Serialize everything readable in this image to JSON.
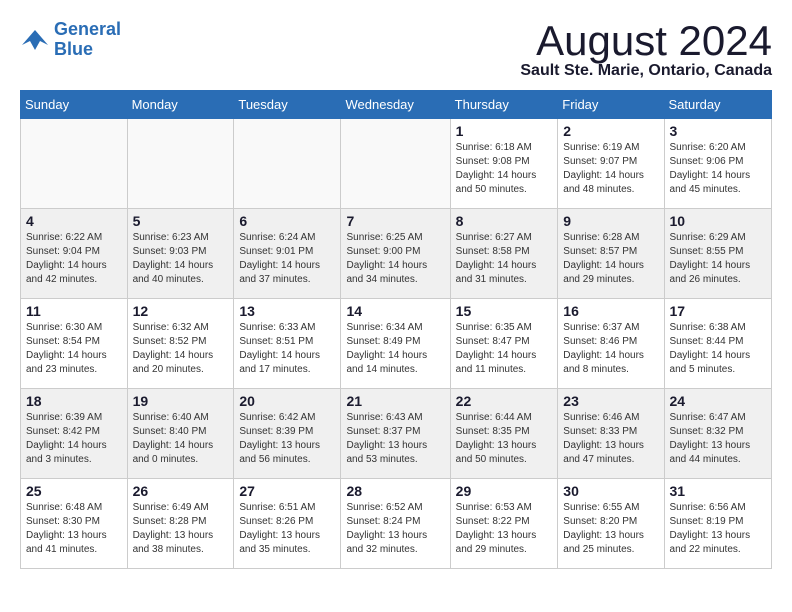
{
  "logo": {
    "line1": "General",
    "line2": "Blue"
  },
  "title": "August 2024",
  "location": "Sault Ste. Marie, Ontario, Canada",
  "headers": [
    "Sunday",
    "Monday",
    "Tuesday",
    "Wednesday",
    "Thursday",
    "Friday",
    "Saturday"
  ],
  "weeks": [
    [
      {
        "day": "",
        "info": ""
      },
      {
        "day": "",
        "info": ""
      },
      {
        "day": "",
        "info": ""
      },
      {
        "day": "",
        "info": ""
      },
      {
        "day": "1",
        "info": "Sunrise: 6:18 AM\nSunset: 9:08 PM\nDaylight: 14 hours\nand 50 minutes."
      },
      {
        "day": "2",
        "info": "Sunrise: 6:19 AM\nSunset: 9:07 PM\nDaylight: 14 hours\nand 48 minutes."
      },
      {
        "day": "3",
        "info": "Sunrise: 6:20 AM\nSunset: 9:06 PM\nDaylight: 14 hours\nand 45 minutes."
      }
    ],
    [
      {
        "day": "4",
        "info": "Sunrise: 6:22 AM\nSunset: 9:04 PM\nDaylight: 14 hours\nand 42 minutes."
      },
      {
        "day": "5",
        "info": "Sunrise: 6:23 AM\nSunset: 9:03 PM\nDaylight: 14 hours\nand 40 minutes."
      },
      {
        "day": "6",
        "info": "Sunrise: 6:24 AM\nSunset: 9:01 PM\nDaylight: 14 hours\nand 37 minutes."
      },
      {
        "day": "7",
        "info": "Sunrise: 6:25 AM\nSunset: 9:00 PM\nDaylight: 14 hours\nand 34 minutes."
      },
      {
        "day": "8",
        "info": "Sunrise: 6:27 AM\nSunset: 8:58 PM\nDaylight: 14 hours\nand 31 minutes."
      },
      {
        "day": "9",
        "info": "Sunrise: 6:28 AM\nSunset: 8:57 PM\nDaylight: 14 hours\nand 29 minutes."
      },
      {
        "day": "10",
        "info": "Sunrise: 6:29 AM\nSunset: 8:55 PM\nDaylight: 14 hours\nand 26 minutes."
      }
    ],
    [
      {
        "day": "11",
        "info": "Sunrise: 6:30 AM\nSunset: 8:54 PM\nDaylight: 14 hours\nand 23 minutes."
      },
      {
        "day": "12",
        "info": "Sunrise: 6:32 AM\nSunset: 8:52 PM\nDaylight: 14 hours\nand 20 minutes."
      },
      {
        "day": "13",
        "info": "Sunrise: 6:33 AM\nSunset: 8:51 PM\nDaylight: 14 hours\nand 17 minutes."
      },
      {
        "day": "14",
        "info": "Sunrise: 6:34 AM\nSunset: 8:49 PM\nDaylight: 14 hours\nand 14 minutes."
      },
      {
        "day": "15",
        "info": "Sunrise: 6:35 AM\nSunset: 8:47 PM\nDaylight: 14 hours\nand 11 minutes."
      },
      {
        "day": "16",
        "info": "Sunrise: 6:37 AM\nSunset: 8:46 PM\nDaylight: 14 hours\nand 8 minutes."
      },
      {
        "day": "17",
        "info": "Sunrise: 6:38 AM\nSunset: 8:44 PM\nDaylight: 14 hours\nand 5 minutes."
      }
    ],
    [
      {
        "day": "18",
        "info": "Sunrise: 6:39 AM\nSunset: 8:42 PM\nDaylight: 14 hours\nand 3 minutes."
      },
      {
        "day": "19",
        "info": "Sunrise: 6:40 AM\nSunset: 8:40 PM\nDaylight: 14 hours\nand 0 minutes."
      },
      {
        "day": "20",
        "info": "Sunrise: 6:42 AM\nSunset: 8:39 PM\nDaylight: 13 hours\nand 56 minutes."
      },
      {
        "day": "21",
        "info": "Sunrise: 6:43 AM\nSunset: 8:37 PM\nDaylight: 13 hours\nand 53 minutes."
      },
      {
        "day": "22",
        "info": "Sunrise: 6:44 AM\nSunset: 8:35 PM\nDaylight: 13 hours\nand 50 minutes."
      },
      {
        "day": "23",
        "info": "Sunrise: 6:46 AM\nSunset: 8:33 PM\nDaylight: 13 hours\nand 47 minutes."
      },
      {
        "day": "24",
        "info": "Sunrise: 6:47 AM\nSunset: 8:32 PM\nDaylight: 13 hours\nand 44 minutes."
      }
    ],
    [
      {
        "day": "25",
        "info": "Sunrise: 6:48 AM\nSunset: 8:30 PM\nDaylight: 13 hours\nand 41 minutes."
      },
      {
        "day": "26",
        "info": "Sunrise: 6:49 AM\nSunset: 8:28 PM\nDaylight: 13 hours\nand 38 minutes."
      },
      {
        "day": "27",
        "info": "Sunrise: 6:51 AM\nSunset: 8:26 PM\nDaylight: 13 hours\nand 35 minutes."
      },
      {
        "day": "28",
        "info": "Sunrise: 6:52 AM\nSunset: 8:24 PM\nDaylight: 13 hours\nand 32 minutes."
      },
      {
        "day": "29",
        "info": "Sunrise: 6:53 AM\nSunset: 8:22 PM\nDaylight: 13 hours\nand 29 minutes."
      },
      {
        "day": "30",
        "info": "Sunrise: 6:55 AM\nSunset: 8:20 PM\nDaylight: 13 hours\nand 25 minutes."
      },
      {
        "day": "31",
        "info": "Sunrise: 6:56 AM\nSunset: 8:19 PM\nDaylight: 13 hours\nand 22 minutes."
      }
    ]
  ]
}
